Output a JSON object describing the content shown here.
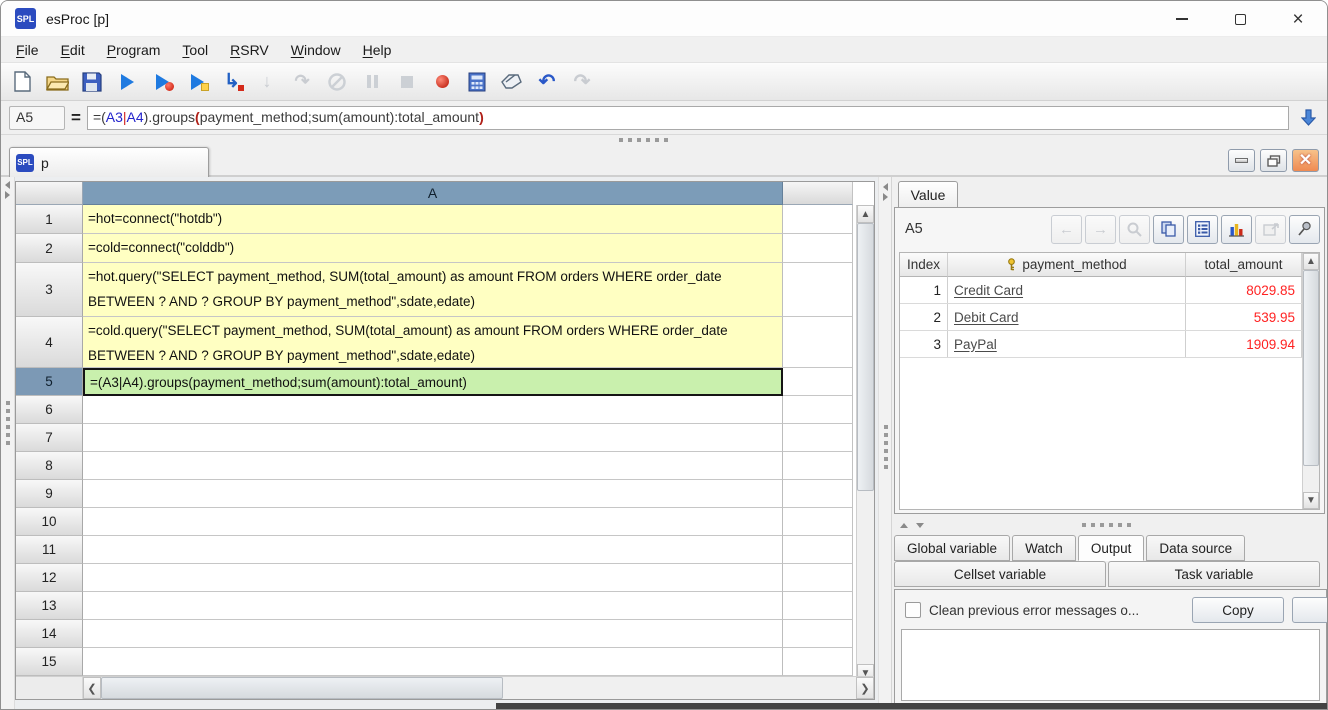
{
  "colors": {
    "header_blue": "#7c9cb8",
    "cell_yellow": "#ffffc2",
    "cell_green": "#c9f0ad",
    "value_red": "#ff2222",
    "logo_blue": "#2b4bbf"
  },
  "window": {
    "logo_text": "SPL",
    "title": "esProc  [p]"
  },
  "menu": {
    "items": [
      {
        "first": "F",
        "rest": "ile"
      },
      {
        "first": "E",
        "rest": "dit"
      },
      {
        "first": "P",
        "rest": "rogram"
      },
      {
        "first": "T",
        "rest": "ool"
      },
      {
        "first": "R",
        "rest": "SRV"
      },
      {
        "first": "W",
        "rest": "indow"
      },
      {
        "first": "H",
        "rest": "elp"
      }
    ]
  },
  "toolbar": {
    "icons": [
      "new-file",
      "open-file",
      "save",
      "execute",
      "debug-execute",
      "step-execute",
      "run-current-cell",
      "step-into",
      "step-return",
      "interrupt",
      "pause",
      "stop",
      "breakpoint",
      "calculator",
      "clear",
      "undo",
      "redo"
    ]
  },
  "formula_bar": {
    "cell_ref": "A5",
    "equals": "=",
    "parts": {
      "p0": "=(",
      "a3": "A3",
      "pipe": "|",
      "a4": "A4",
      "mid": ").groups",
      "open": "(",
      "body": "payment_method;sum(amount):total_amount",
      "close": ")"
    }
  },
  "doc_tab": {
    "logo_text": "SPL",
    "label": "p"
  },
  "grid": {
    "col_header": "A",
    "rows": [
      {
        "num": "1",
        "text": "=hot=connect(\"hotdb\")"
      },
      {
        "num": "2",
        "text": "=cold=connect(\"colddb\")"
      },
      {
        "num": "3",
        "text": "=hot.query(\"SELECT payment_method, SUM(total_amount) as amount FROM orders WHERE order_date BETWEEN ? AND ? GROUP BY payment_method\",sdate,edate)"
      },
      {
        "num": "4",
        "text": "=cold.query(\"SELECT payment_method, SUM(total_amount) as amount FROM orders WHERE order_date BETWEEN ? AND ? GROUP BY payment_method\",sdate,edate)"
      },
      {
        "num": "5",
        "text": "=(A3|A4).groups(payment_method;sum(amount):total_amount)"
      },
      {
        "num": "6",
        "text": ""
      },
      {
        "num": "7",
        "text": ""
      },
      {
        "num": "8",
        "text": ""
      },
      {
        "num": "9",
        "text": ""
      },
      {
        "num": "10",
        "text": ""
      },
      {
        "num": "11",
        "text": ""
      },
      {
        "num": "12",
        "text": ""
      },
      {
        "num": "13",
        "text": ""
      },
      {
        "num": "14",
        "text": ""
      },
      {
        "num": "15",
        "text": ""
      }
    ]
  },
  "value_panel": {
    "tab_label": "Value",
    "cell_ref": "A5",
    "table": {
      "headers": {
        "index": "Index",
        "method": "payment_method",
        "amount": "total_amount"
      },
      "rows": [
        {
          "index": "1",
          "method": "Credit Card",
          "amount": "8029.85"
        },
        {
          "index": "2",
          "method": "Debit Card",
          "amount": "539.95"
        },
        {
          "index": "3",
          "method": "PayPal",
          "amount": "1909.94"
        }
      ]
    }
  },
  "bottom_tabs": {
    "row1": {
      "t0": "Global variable",
      "t1": "Watch",
      "t2": "Output",
      "t3": "Data source"
    },
    "row2": {
      "t0": "Cellset variable",
      "t1": "Task variable"
    },
    "active": "Output"
  },
  "output_panel": {
    "checkbox_label": "Clean previous error messages o...",
    "copy_button": "Copy"
  }
}
